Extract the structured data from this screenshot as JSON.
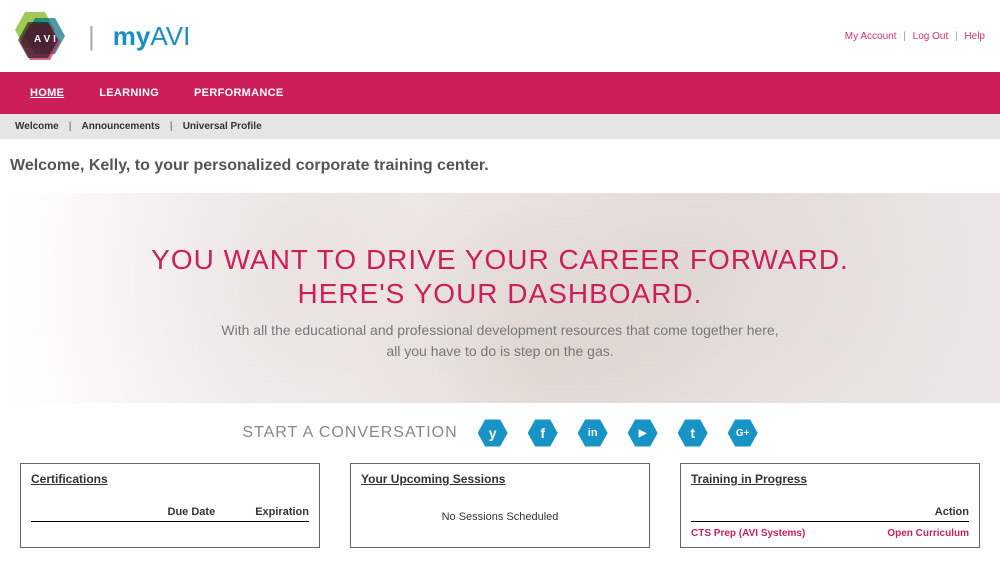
{
  "brand": {
    "text_my": "my",
    "text_avi": "AVI"
  },
  "top_links": {
    "account": "My Account",
    "logout": "Log Out",
    "help": "Help"
  },
  "nav": {
    "home": "HOME",
    "learning": "LEARNING",
    "performance": "PERFORMANCE"
  },
  "subnav": {
    "welcome": "Welcome",
    "announcements": "Announcements",
    "profile": "Universal Profile"
  },
  "welcome": "Welcome, Kelly, to your personalized corporate training center.",
  "hero": {
    "line1": "YOU WANT TO DRIVE YOUR CAREER FORWARD.",
    "line2": "HERE'S YOUR DASHBOARD.",
    "sub1": "With all the educational and professional development resources that come together here,",
    "sub2": "all you have to do is step on the gas."
  },
  "convo_label": "START A CONVERSATION",
  "social": {
    "yammer": "y",
    "facebook": "f",
    "linkedin": "in",
    "youtube": "▶",
    "twitter": "t",
    "gplus": "G+"
  },
  "panels": {
    "cert": {
      "title": "Certifications",
      "col_due": "Due Date",
      "col_exp": "Expiration"
    },
    "sessions": {
      "title": "Your Upcoming Sessions",
      "empty": "No Sessions Scheduled"
    },
    "training": {
      "title": "Training in Progress",
      "col_action": "Action",
      "rows": [
        {
          "name": "CTS Prep (AVI Systems)",
          "action": "Open Curriculum"
        }
      ]
    }
  }
}
